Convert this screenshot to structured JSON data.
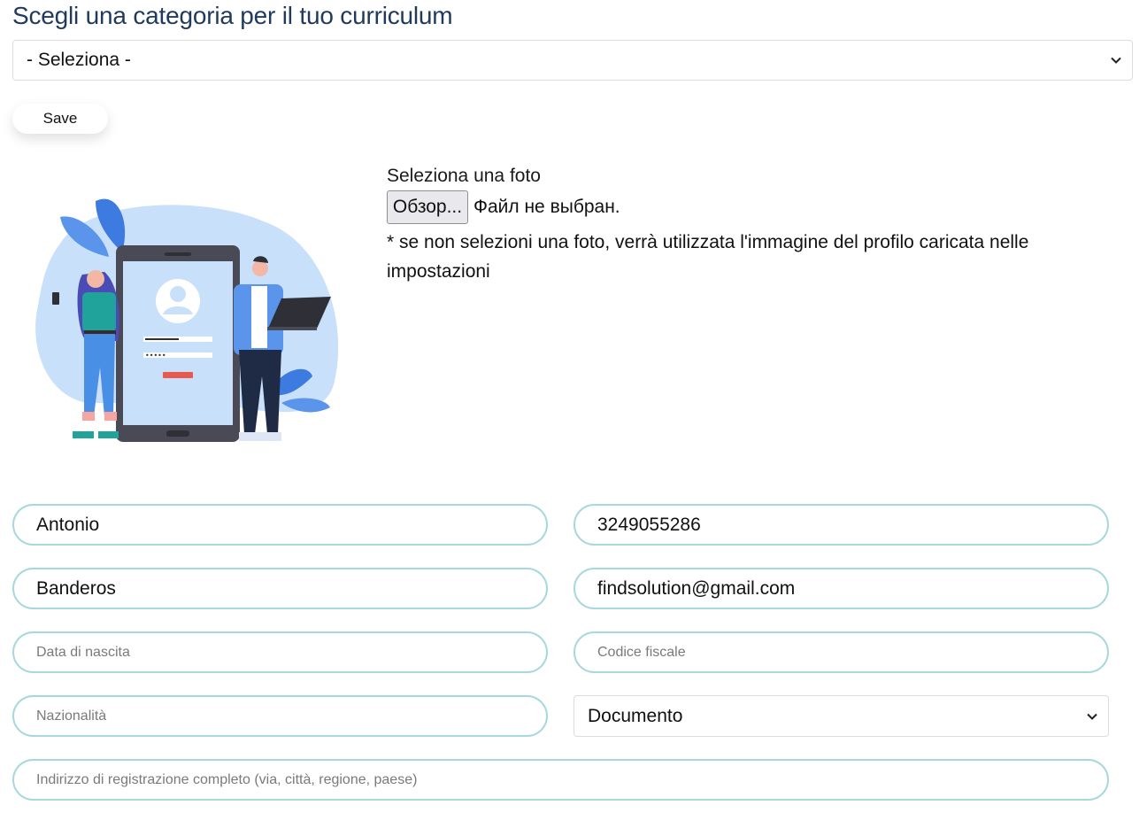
{
  "header": {
    "title": "Scegli una categoria per il tuo curriculum"
  },
  "category_select": {
    "selected": "- Seleziona -",
    "icon": "chevron-down-icon"
  },
  "save_button": {
    "label": "Save"
  },
  "photo": {
    "label": "Seleziona una foto",
    "browse_label": "Обзор...",
    "file_status": "Файл не выбран.",
    "note": "* se non selezioni una foto, verrà utilizzata l'immagine del profilo caricata nelle impostazioni"
  },
  "form": {
    "first_name": {
      "value": "Antonio"
    },
    "phone": {
      "value": "3249055286"
    },
    "last_name": {
      "value": "Banderos"
    },
    "email": {
      "value": "findsolution@gmail.com"
    },
    "birth_date": {
      "placeholder": "Data di nascita"
    },
    "tax_code": {
      "placeholder": "Codice fiscale"
    },
    "nationality": {
      "placeholder": "Nazionalità"
    },
    "document": {
      "selected": "Documento",
      "icon": "chevron-down-icon"
    },
    "address": {
      "placeholder": "Indirizzo di registrazione completo (via, città, regione, paese)"
    }
  },
  "colors": {
    "title": "#1f3a5c",
    "field_border": "#a7d8de",
    "illustration_blob": "#c9e0fb",
    "illustration_accent": "#3d7be0"
  }
}
